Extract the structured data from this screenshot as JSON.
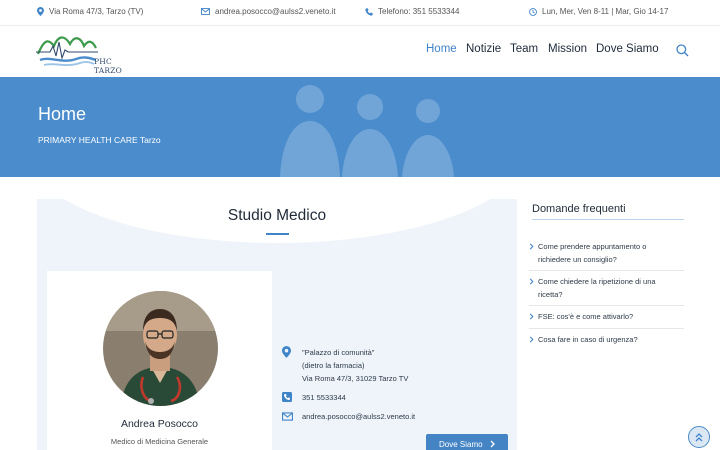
{
  "topbar": {
    "address": "Via Roma 47/3, Tarzo (TV)",
    "email": "andrea.posocco@aulss2.veneto.it",
    "phone": "Telefono: 351 5533344",
    "hours": "Lun, Mer, Ven 8-11 | Mar, Gio 14-17"
  },
  "header": {
    "logo_text": "PHC TARZO",
    "nav": [
      {
        "label": "Home",
        "active": true
      },
      {
        "label": "Notizie",
        "active": false
      },
      {
        "label": "Team",
        "active": false
      },
      {
        "label": "Mission",
        "active": false
      },
      {
        "label": "Dove Siamo",
        "active": false
      }
    ]
  },
  "hero": {
    "title": "Home",
    "subtitle": "PRIMARY HEALTH CARE Tarzo"
  },
  "main": {
    "title": "Studio Medico",
    "doctor": {
      "name": "Andrea Posocco",
      "role": "Medico di Medicina Generale"
    },
    "location": {
      "line1": "\"Palazzo di comunità\"",
      "line2": "(dietro la farmacia)",
      "line3": "Via Roma 47/3, 31029 Tarzo TV"
    },
    "phone": "351 5533344",
    "email": "andrea.posocco@aulss2.veneto.it",
    "button_label": "Dove Siamo"
  },
  "faq": {
    "title": "Domande frequenti",
    "items": [
      {
        "line1": "Come prendere appuntamento o",
        "line2": "richiedere un consiglio?"
      },
      {
        "line1": "Come chiedere la ripetizione di una",
        "line2": "ricetta?"
      },
      {
        "line1": "FSE: cos'è e come attivarlo?",
        "line2": ""
      },
      {
        "line1": "Cosa fare in caso di urgenza?",
        "line2": ""
      }
    ]
  },
  "colors": {
    "accent": "#3f83c9",
    "hero_bg": "#4a8ccc",
    "card_bg": "#eef4fa",
    "button_bg": "#4484c4"
  },
  "icons": {
    "address": "map-pin-icon",
    "email": "envelope-icon",
    "phone": "phone-icon",
    "hours": "clock-icon",
    "search": "search-icon",
    "scroll_top": "double-chevron-up-icon"
  }
}
